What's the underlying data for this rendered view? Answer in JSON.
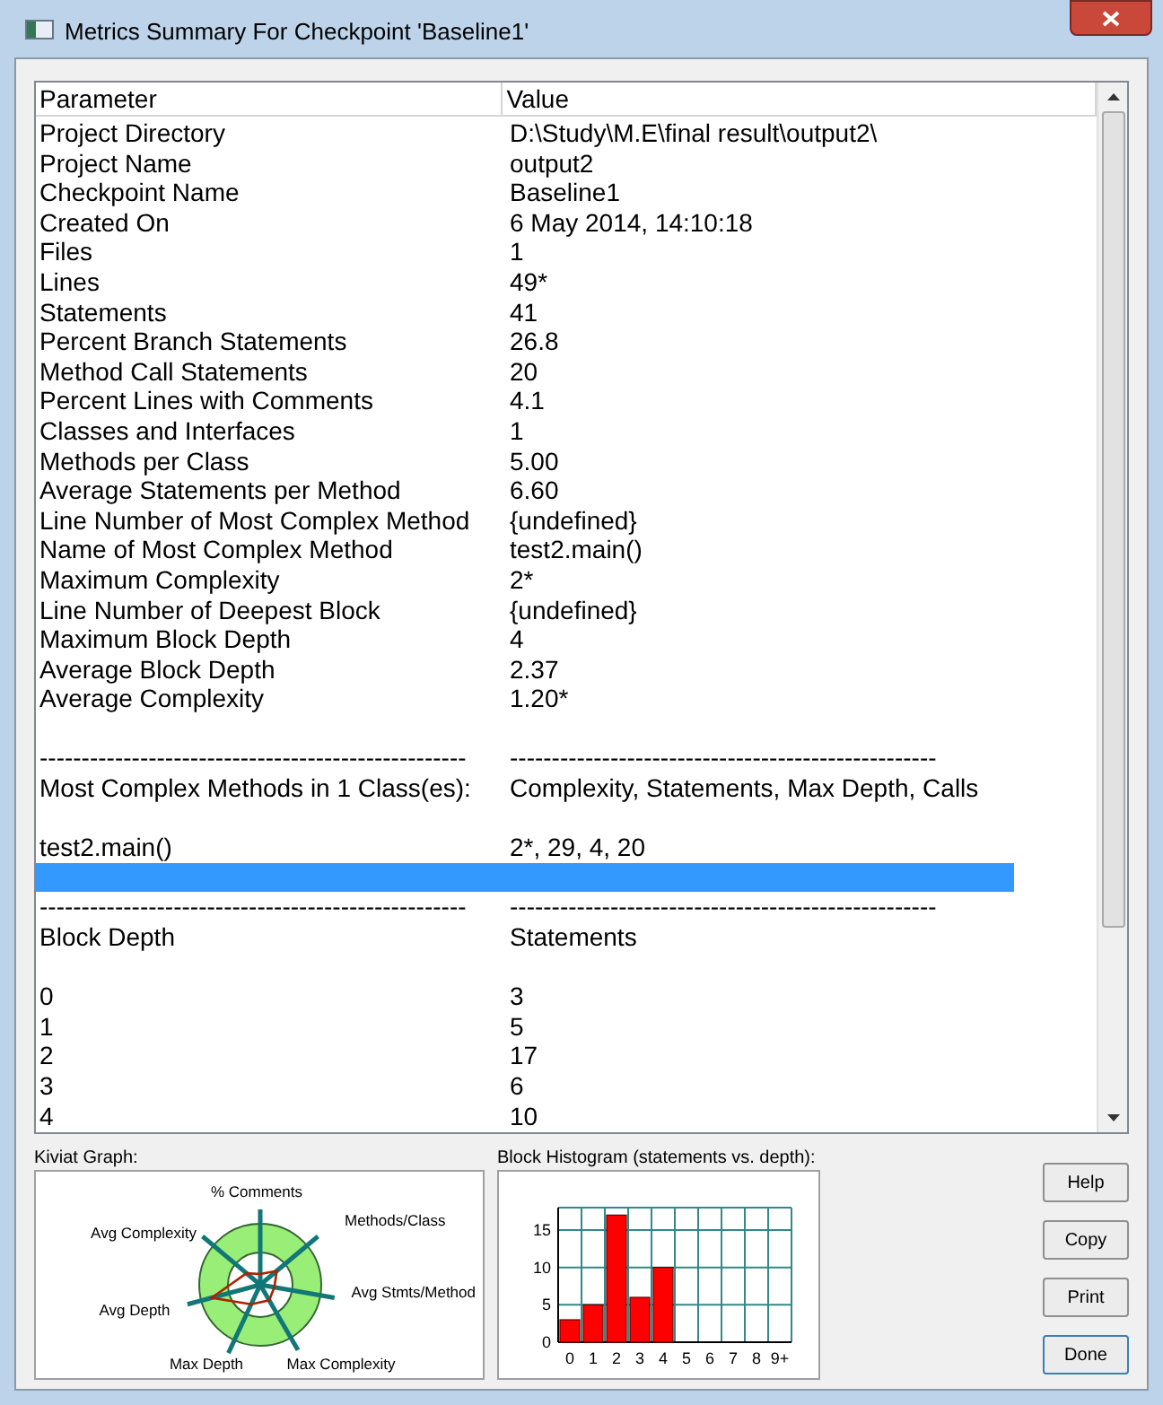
{
  "window": {
    "title": "Metrics Summary For Checkpoint 'Baseline1'"
  },
  "list": {
    "columns": [
      "Parameter",
      "Value"
    ],
    "rows": [
      {
        "kind": "data",
        "cells": [
          "Project Directory",
          "D:\\Study\\M.E\\final result\\output2\\"
        ],
        "selected": false
      },
      {
        "kind": "data",
        "cells": [
          "Project Name",
          "output2"
        ],
        "selected": false
      },
      {
        "kind": "data",
        "cells": [
          "Checkpoint Name",
          "Baseline1"
        ],
        "selected": false
      },
      {
        "kind": "data",
        "cells": [
          "Created On",
          "6 May 2014, 14:10:18"
        ],
        "selected": false
      },
      {
        "kind": "data",
        "cells": [
          "Files",
          "1"
        ],
        "selected": false
      },
      {
        "kind": "data",
        "cells": [
          "Lines",
          "49*"
        ],
        "selected": false
      },
      {
        "kind": "data",
        "cells": [
          "Statements",
          "41"
        ],
        "selected": false
      },
      {
        "kind": "data",
        "cells": [
          "Percent Branch Statements",
          "26.8"
        ],
        "selected": false
      },
      {
        "kind": "data",
        "cells": [
          "Method Call Statements",
          "20"
        ],
        "selected": false
      },
      {
        "kind": "data",
        "cells": [
          "Percent Lines with Comments",
          "4.1"
        ],
        "selected": false
      },
      {
        "kind": "data",
        "cells": [
          "Classes and Interfaces",
          "1"
        ],
        "selected": false
      },
      {
        "kind": "data",
        "cells": [
          "Methods per Class",
          "5.00"
        ],
        "selected": false
      },
      {
        "kind": "data",
        "cells": [
          "Average Statements per Method",
          "6.60"
        ],
        "selected": false
      },
      {
        "kind": "data",
        "cells": [
          "Line Number of Most Complex Method",
          "{undefined}"
        ],
        "selected": false
      },
      {
        "kind": "data",
        "cells": [
          "Name of Most Complex Method",
          "test2.main()"
        ],
        "selected": false
      },
      {
        "kind": "data",
        "cells": [
          "Maximum Complexity",
          "2*"
        ],
        "selected": false
      },
      {
        "kind": "data",
        "cells": [
          "Line Number of Deepest Block",
          "{undefined}"
        ],
        "selected": false
      },
      {
        "kind": "data",
        "cells": [
          "Maximum Block Depth",
          "4"
        ],
        "selected": false
      },
      {
        "kind": "data",
        "cells": [
          "Average Block Depth",
          "2.37"
        ],
        "selected": false
      },
      {
        "kind": "data",
        "cells": [
          "Average Complexity",
          "1.20*"
        ],
        "selected": false
      },
      {
        "kind": "blank",
        "selected": false
      },
      {
        "kind": "data",
        "cells": [
          "---------------------------------------------------",
          "---------------------------------------------------"
        ],
        "selected": false
      },
      {
        "kind": "data",
        "cells": [
          "Most Complex Methods in 1 Class(es):",
          "Complexity, Statements, Max Depth, Calls"
        ],
        "selected": false
      },
      {
        "kind": "blank",
        "selected": false
      },
      {
        "kind": "data",
        "cells": [
          "test2.main()",
          "2*, 29, 4, 20"
        ],
        "selected": false
      },
      {
        "kind": "blank",
        "selected": true
      },
      {
        "kind": "data",
        "cells": [
          "---------------------------------------------------",
          "---------------------------------------------------"
        ],
        "selected": false
      },
      {
        "kind": "data",
        "cells": [
          "Block Depth",
          "Statements"
        ],
        "selected": false
      },
      {
        "kind": "blank",
        "selected": false
      },
      {
        "kind": "data",
        "cells": [
          "0",
          "3"
        ],
        "selected": false
      },
      {
        "kind": "data",
        "cells": [
          "1",
          "5"
        ],
        "selected": false
      },
      {
        "kind": "data",
        "cells": [
          "2",
          "17"
        ],
        "selected": false
      },
      {
        "kind": "data",
        "cells": [
          "3",
          "6"
        ],
        "selected": false
      },
      {
        "kind": "data",
        "cells": [
          "4",
          "10"
        ],
        "selected": false
      }
    ]
  },
  "kiviat": {
    "label": "Kiviat Graph:",
    "axes": [
      "% Comments",
      "Methods/Class",
      "Avg Complexity",
      "Avg Stmts/Method",
      "Avg Depth",
      "Max Depth",
      "Max Complexity"
    ]
  },
  "histogram": {
    "label": "Block Histogram (statements vs. depth):",
    "chart_data": {
      "type": "bar",
      "categories": [
        "0",
        "1",
        "2",
        "3",
        "4",
        "5",
        "6",
        "7",
        "8",
        "9+"
      ],
      "values": [
        3,
        5,
        17,
        6,
        10,
        0,
        0,
        0,
        0,
        0
      ],
      "ylim": [
        0,
        18
      ],
      "yticks": [
        0,
        5,
        10,
        15
      ],
      "grid": true
    }
  },
  "buttons": [
    "Help",
    "Copy",
    "Print",
    "Done"
  ]
}
